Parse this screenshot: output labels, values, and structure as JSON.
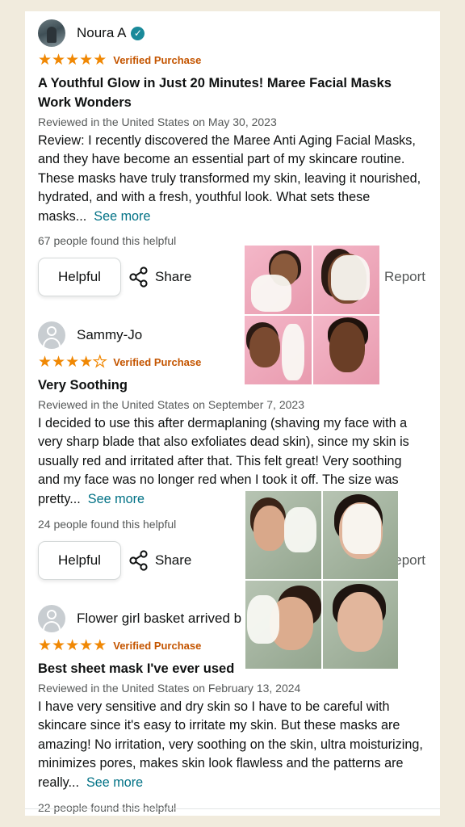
{
  "reviews": [
    {
      "name": "Noura A",
      "verified_badge": "✓",
      "rating": 5,
      "verified_label": "Verified Purchase",
      "title": "A Youthful Glow in Just 20 Minutes! Maree Facial Masks Work Wonders",
      "meta": "Reviewed in the United States on May 30, 2023",
      "body": "Review: I recently discovered the Maree Anti Aging Facial Masks, and they have become an essential part of my skincare routine. These masks have truly transformed my skin, leaving it nourished, hydrated, and with a fresh, youthful look. What sets these masks...",
      "see_more": "See more",
      "helpful_count": "67 people found this helpful",
      "helpful_label": "Helpful",
      "share_label": "Share",
      "report_label": "Report"
    },
    {
      "name": "Sammy-Jo",
      "rating": 4,
      "verified_label": "Verified Purchase",
      "title": "Very Soothing",
      "meta": "Reviewed in the United States on September 7, 2023",
      "body": "I decided to use this after dermaplaning (shaving my face with a very sharp blade that also exfoliates dead skin), since my skin is usually red and irritated after that. This felt great! Very soothing and my face was no longer red when I took it off. The size was pretty...",
      "see_more": "See more",
      "helpful_count": "24 people found this helpful",
      "helpful_label": "Helpful",
      "share_label": "Share",
      "report_label": "Report"
    },
    {
      "name": "Flower girl basket arrived b",
      "rating": 5,
      "verified_label": "Verified Purchase",
      "title": "Best sheet mask I've ever used",
      "meta": "Reviewed in the United States on February 13, 2024",
      "body": "I have very sensitive and dry skin so I have to be careful with skincare since it's easy to irritate my skin. But these masks are amazing! No irritation, very soothing on the skin, ultra moisturizing, minimizes pores, makes skin look flawless and the patterns are really...",
      "see_more": "See more",
      "helpful_count": "22 people found this helpful"
    }
  ],
  "icons": {
    "star": "★",
    "share": "share-icon",
    "avatar": "person-icon"
  },
  "colors": {
    "star": "#f08804",
    "verified_purchase": "#c45500",
    "link": "#007185",
    "badge": "#1a8a9a",
    "background": "#f1ebdd"
  }
}
